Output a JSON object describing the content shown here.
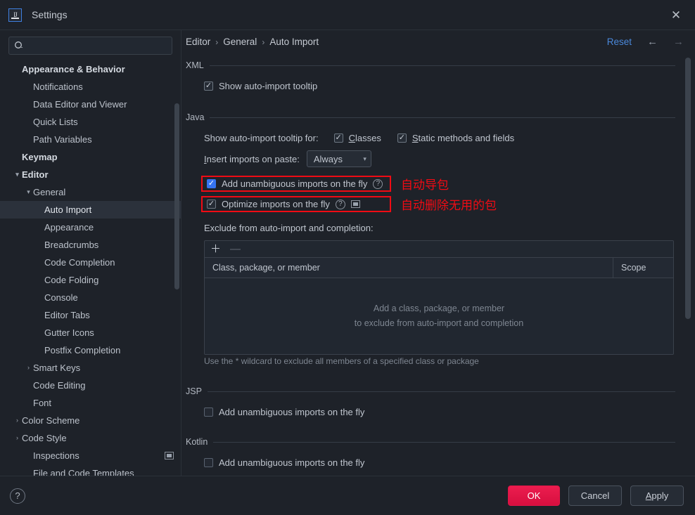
{
  "window": {
    "title": "Settings",
    "logo_icon": "intellij-idea-icon",
    "close_icon": "close-icon"
  },
  "sidebar": {
    "search": {
      "placeholder": "",
      "value": "",
      "icon": "search-icon"
    },
    "items": [
      {
        "label": "Appearance & Behavior",
        "indent": 0,
        "twisty": "",
        "bold": true,
        "selected": false,
        "badge": false
      },
      {
        "label": "Notifications",
        "indent": 1,
        "twisty": "",
        "bold": false,
        "selected": false,
        "badge": false
      },
      {
        "label": "Data Editor and Viewer",
        "indent": 1,
        "twisty": "",
        "bold": false,
        "selected": false,
        "badge": false
      },
      {
        "label": "Quick Lists",
        "indent": 1,
        "twisty": "",
        "bold": false,
        "selected": false,
        "badge": false
      },
      {
        "label": "Path Variables",
        "indent": 1,
        "twisty": "",
        "bold": false,
        "selected": false,
        "badge": false
      },
      {
        "label": "Keymap",
        "indent": 0,
        "twisty": "",
        "bold": true,
        "selected": false,
        "badge": false
      },
      {
        "label": "Editor",
        "indent": 0,
        "twisty": "▾",
        "bold": true,
        "selected": false,
        "badge": false
      },
      {
        "label": "General",
        "indent": 1,
        "twisty": "▾",
        "bold": false,
        "selected": false,
        "badge": false
      },
      {
        "label": "Auto Import",
        "indent": 2,
        "twisty": "",
        "bold": false,
        "selected": true,
        "badge": false
      },
      {
        "label": "Appearance",
        "indent": 2,
        "twisty": "",
        "bold": false,
        "selected": false,
        "badge": false
      },
      {
        "label": "Breadcrumbs",
        "indent": 2,
        "twisty": "",
        "bold": false,
        "selected": false,
        "badge": false
      },
      {
        "label": "Code Completion",
        "indent": 2,
        "twisty": "",
        "bold": false,
        "selected": false,
        "badge": false
      },
      {
        "label": "Code Folding",
        "indent": 2,
        "twisty": "",
        "bold": false,
        "selected": false,
        "badge": false
      },
      {
        "label": "Console",
        "indent": 2,
        "twisty": "",
        "bold": false,
        "selected": false,
        "badge": false
      },
      {
        "label": "Editor Tabs",
        "indent": 2,
        "twisty": "",
        "bold": false,
        "selected": false,
        "badge": false
      },
      {
        "label": "Gutter Icons",
        "indent": 2,
        "twisty": "",
        "bold": false,
        "selected": false,
        "badge": false
      },
      {
        "label": "Postfix Completion",
        "indent": 2,
        "twisty": "",
        "bold": false,
        "selected": false,
        "badge": false
      },
      {
        "label": "Smart Keys",
        "indent": 1,
        "twisty": "›",
        "bold": false,
        "selected": false,
        "badge": false
      },
      {
        "label": "Code Editing",
        "indent": 1,
        "twisty": "",
        "bold": false,
        "selected": false,
        "badge": false
      },
      {
        "label": "Font",
        "indent": 1,
        "twisty": "",
        "bold": false,
        "selected": false,
        "badge": false
      },
      {
        "label": "Color Scheme",
        "indent": 0,
        "twisty": "›",
        "bold": false,
        "selected": false,
        "badge": false
      },
      {
        "label": "Code Style",
        "indent": 0,
        "twisty": "›",
        "bold": false,
        "selected": false,
        "badge": false
      },
      {
        "label": "Inspections",
        "indent": 1,
        "twisty": "",
        "bold": false,
        "selected": false,
        "badge": true
      },
      {
        "label": "File and Code Templates",
        "indent": 1,
        "twisty": "",
        "bold": false,
        "selected": false,
        "badge": false
      }
    ]
  },
  "breadcrumb": {
    "crumbs": [
      "Editor",
      "General",
      "Auto Import"
    ],
    "separator": "›",
    "reset_label": "Reset",
    "back_icon": "arrow-left-icon",
    "forward_icon": "arrow-right-icon"
  },
  "sections": {
    "xml": {
      "title": "XML",
      "show_tooltip": {
        "label": "Show auto-import tooltip",
        "checked": true
      }
    },
    "java": {
      "title": "Java",
      "tooltip_for_label": "Show auto-import tooltip for:",
      "classes": {
        "label": "Classes",
        "mnemonic": "C",
        "checked": true
      },
      "static_methods": {
        "label": "Static methods and fields",
        "mnemonic": "S",
        "checked": true
      },
      "insert_imports_label": "Insert imports on paste:",
      "insert_imports_mnemonic": "I",
      "insert_imports_value": "Always",
      "add_unambiguous": {
        "label": "Add unambiguous imports on the fly",
        "checked": true
      },
      "optimize_imports": {
        "label": "Optimize imports on the fly",
        "checked": true
      },
      "annotation_add": "自动导包",
      "annotation_optimize": "自动删除无用的包",
      "exclude_label": "Exclude from auto-import and completion:",
      "table": {
        "add_icon": "plus-icon",
        "remove_icon": "minus-icon",
        "columns": [
          "Class, package, or member",
          "Scope"
        ],
        "empty_line1": "Add a class, package, or member",
        "empty_line2": "to exclude from auto-import and completion",
        "rows": []
      },
      "wildcard_hint": "Use the * wildcard to exclude all members of a specified class or package"
    },
    "jsp": {
      "title": "JSP",
      "add_unambiguous": {
        "label": "Add unambiguous imports on the fly",
        "checked": false
      }
    },
    "kotlin": {
      "title": "Kotlin",
      "add_unambiguous": {
        "label": "Add unambiguous imports on the fly",
        "checked": false
      }
    }
  },
  "footer": {
    "help_icon": "question-mark-icon",
    "ok_label": "OK",
    "cancel_label": "Cancel",
    "apply_label": "Apply",
    "apply_mnemonic": "A"
  },
  "colors": {
    "accent_blue": "#3574f0",
    "link_blue": "#4a88da",
    "annotation_red": "#f00b14",
    "ok_button": "#e21447",
    "background": "#1e2229"
  }
}
